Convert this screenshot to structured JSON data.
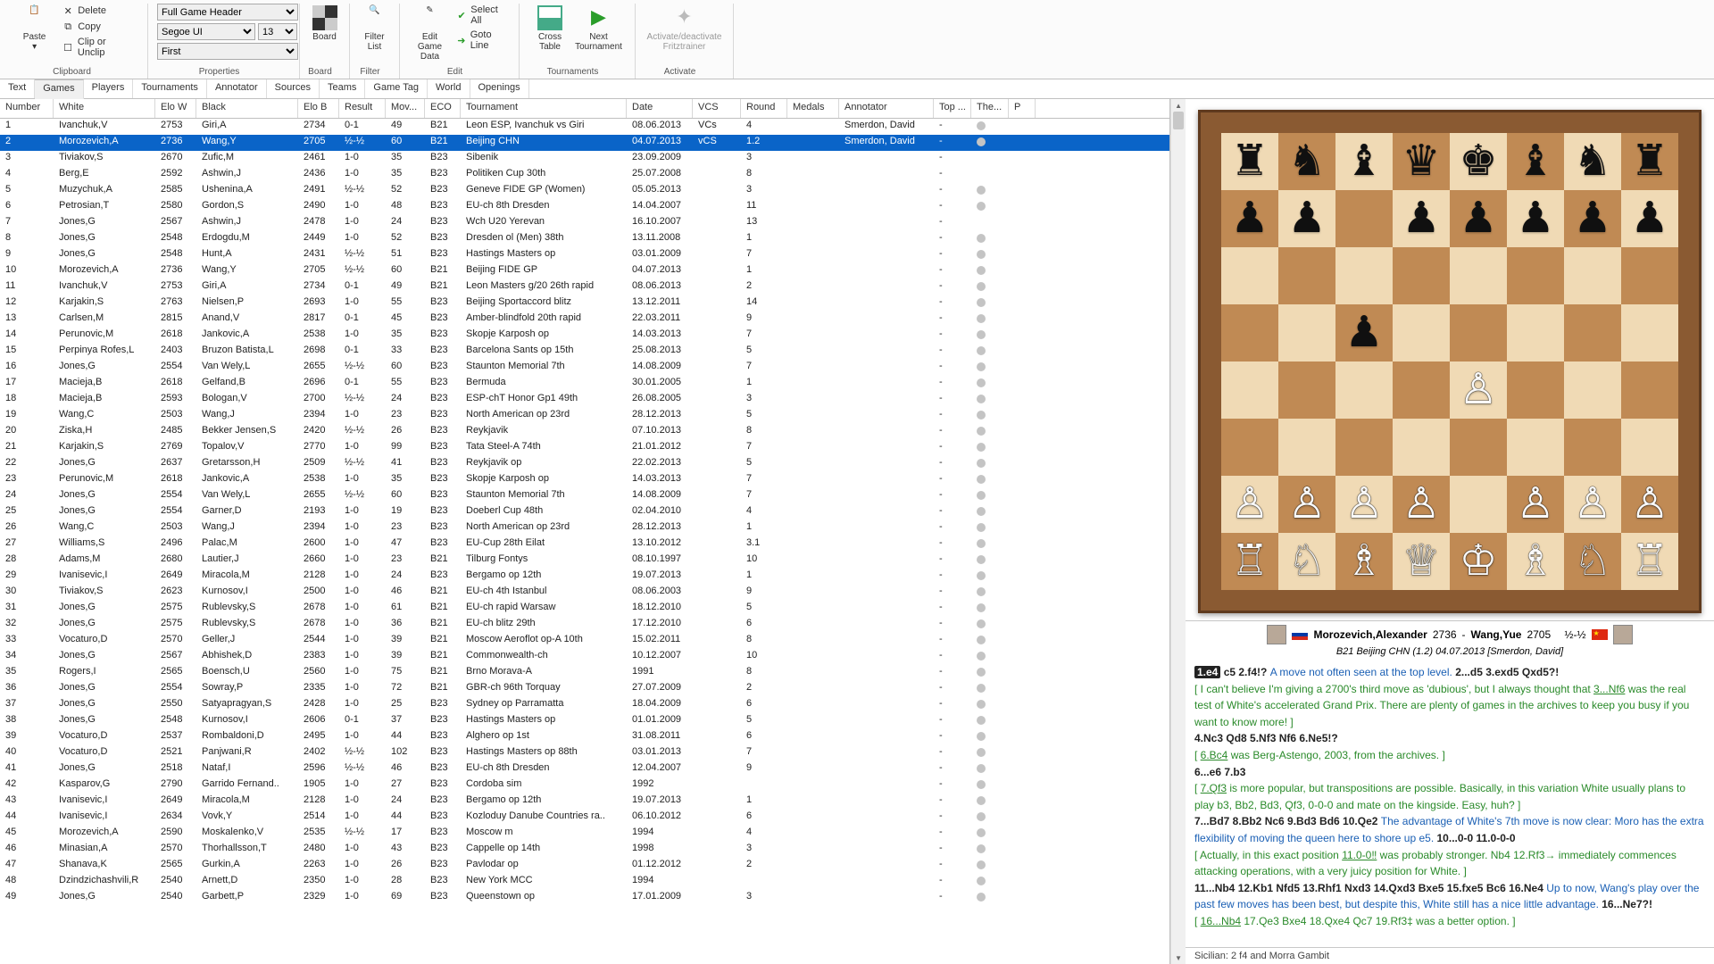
{
  "ribbon": {
    "clipboard": {
      "label": "Clipboard",
      "paste": "Paste",
      "delete": "Delete",
      "copy": "Copy",
      "clip": "Clip or Unclip"
    },
    "properties": {
      "label": "Properties",
      "style": "Full Game Header",
      "font": "Segoe UI",
      "size": "13",
      "row": "First"
    },
    "board_grp": {
      "label": "Board",
      "board": "Board"
    },
    "filter": {
      "label": "Filter",
      "list": "Filter List"
    },
    "edit": {
      "label": "Edit",
      "editgame": "Edit Game Data",
      "selectall": "Select All",
      "gotoline": "Goto Line"
    },
    "tournaments": {
      "label": "Tournaments",
      "cross": "Cross Table",
      "next": "Next Tournament"
    },
    "activate": {
      "label": "Activate",
      "act": "Activate/deactivate Fritztrainer"
    }
  },
  "tabs": [
    "Text",
    "Games",
    "Players",
    "Tournaments",
    "Annotator",
    "Sources",
    "Teams",
    "Game Tag",
    "World",
    "Openings"
  ],
  "active_tab": 1,
  "columns": [
    "Number",
    "White",
    "Elo W",
    "Black",
    "Elo B",
    "Result",
    "Mov...",
    "ECO",
    "Tournament",
    "Date",
    "VCS",
    "Round",
    "Medals",
    "Annotator",
    "Top ...",
    "The...",
    "P"
  ],
  "rows": [
    {
      "n": 1,
      "w": "Ivanchuk,V",
      "ew": 2753,
      "b": "Giri,A",
      "eb": 2734,
      "r": "0-1",
      "m": 49,
      "eco": "B21",
      "t": "Leon ESP, Ivanchuk vs Giri",
      "d": "08.06.2013",
      "vcs": "VCs",
      "rd": "4",
      "ann": "Smerdon, David",
      "top": "-",
      "th": true
    },
    {
      "n": 2,
      "w": "Morozevich,A",
      "ew": 2736,
      "b": "Wang,Y",
      "eb": 2705,
      "r": "½-½",
      "m": 60,
      "eco": "B21",
      "t": "Beijing CHN",
      "d": "04.07.2013",
      "vcs": "vCS",
      "rd": "1.2",
      "ann": "Smerdon, David",
      "top": "-",
      "th": true,
      "sel": true
    },
    {
      "n": 3,
      "w": "Tiviakov,S",
      "ew": 2670,
      "b": "Zufic,M",
      "eb": 2461,
      "r": "1-0",
      "m": 35,
      "eco": "B23",
      "t": "Sibenik",
      "d": "23.09.2009",
      "rd": "3",
      "top": "-"
    },
    {
      "n": 4,
      "w": "Berg,E",
      "ew": 2592,
      "b": "Ashwin,J",
      "eb": 2436,
      "r": "1-0",
      "m": 35,
      "eco": "B23",
      "t": "Politiken Cup 30th",
      "d": "25.07.2008",
      "rd": "8",
      "top": "-"
    },
    {
      "n": 5,
      "w": "Muzychuk,A",
      "ew": 2585,
      "b": "Ushenina,A",
      "eb": 2491,
      "r": "½-½",
      "m": 52,
      "eco": "B23",
      "t": "Geneve FIDE GP (Women)",
      "d": "05.05.2013",
      "rd": "3",
      "top": "-",
      "th": true
    },
    {
      "n": 6,
      "w": "Petrosian,T",
      "ew": 2580,
      "b": "Gordon,S",
      "eb": 2490,
      "r": "1-0",
      "m": 48,
      "eco": "B23",
      "t": "EU-ch 8th Dresden",
      "d": "14.04.2007",
      "rd": "11",
      "top": "-",
      "th": true
    },
    {
      "n": 7,
      "w": "Jones,G",
      "ew": 2567,
      "b": "Ashwin,J",
      "eb": 2478,
      "r": "1-0",
      "m": 24,
      "eco": "B23",
      "t": "Wch U20 Yerevan",
      "d": "16.10.2007",
      "rd": "13",
      "top": "-"
    },
    {
      "n": 8,
      "w": "Jones,G",
      "ew": 2548,
      "b": "Erdogdu,M",
      "eb": 2449,
      "r": "1-0",
      "m": 52,
      "eco": "B23",
      "t": "Dresden ol (Men) 38th",
      "d": "13.11.2008",
      "rd": "1",
      "top": "-",
      "th": true
    },
    {
      "n": 9,
      "w": "Jones,G",
      "ew": 2548,
      "b": "Hunt,A",
      "eb": 2431,
      "r": "½-½",
      "m": 51,
      "eco": "B23",
      "t": "Hastings Masters op",
      "d": "03.01.2009",
      "rd": "7",
      "top": "-",
      "th": true
    },
    {
      "n": 10,
      "w": "Morozevich,A",
      "ew": 2736,
      "b": "Wang,Y",
      "eb": 2705,
      "r": "½-½",
      "m": 60,
      "eco": "B21",
      "t": "Beijing FIDE GP",
      "d": "04.07.2013",
      "rd": "1",
      "top": "-",
      "th": true
    },
    {
      "n": 11,
      "w": "Ivanchuk,V",
      "ew": 2753,
      "b": "Giri,A",
      "eb": 2734,
      "r": "0-1",
      "m": 49,
      "eco": "B21",
      "t": "Leon Masters g/20 26th rapid",
      "d": "08.06.2013",
      "rd": "2",
      "top": "-",
      "th": true
    },
    {
      "n": 12,
      "w": "Karjakin,S",
      "ew": 2763,
      "b": "Nielsen,P",
      "eb": 2693,
      "r": "1-0",
      "m": 55,
      "eco": "B23",
      "t": "Beijing Sportaccord blitz",
      "d": "13.12.2011",
      "rd": "14",
      "top": "-",
      "th": true
    },
    {
      "n": 13,
      "w": "Carlsen,M",
      "ew": 2815,
      "b": "Anand,V",
      "eb": 2817,
      "r": "0-1",
      "m": 45,
      "eco": "B23",
      "t": "Amber-blindfold 20th rapid",
      "d": "22.03.2011",
      "rd": "9",
      "top": "-",
      "th": true
    },
    {
      "n": 14,
      "w": "Perunovic,M",
      "ew": 2618,
      "b": "Jankovic,A",
      "eb": 2538,
      "r": "1-0",
      "m": 35,
      "eco": "B23",
      "t": "Skopje Karposh op",
      "d": "14.03.2013",
      "rd": "7",
      "top": "-",
      "th": true
    },
    {
      "n": 15,
      "w": "Perpinya Rofes,L",
      "ew": 2403,
      "b": "Bruzon Batista,L",
      "eb": 2698,
      "r": "0-1",
      "m": 33,
      "eco": "B23",
      "t": "Barcelona Sants op 15th",
      "d": "25.08.2013",
      "rd": "5",
      "top": "-",
      "th": true
    },
    {
      "n": 16,
      "w": "Jones,G",
      "ew": 2554,
      "b": "Van Wely,L",
      "eb": 2655,
      "r": "½-½",
      "m": 60,
      "eco": "B23",
      "t": "Staunton Memorial 7th",
      "d": "14.08.2009",
      "rd": "7",
      "top": "-",
      "th": true
    },
    {
      "n": 17,
      "w": "Macieja,B",
      "ew": 2618,
      "b": "Gelfand,B",
      "eb": 2696,
      "r": "0-1",
      "m": 55,
      "eco": "B23",
      "t": "Bermuda",
      "d": "30.01.2005",
      "rd": "1",
      "top": "-",
      "th": true
    },
    {
      "n": 18,
      "w": "Macieja,B",
      "ew": 2593,
      "b": "Bologan,V",
      "eb": 2700,
      "r": "½-½",
      "m": 24,
      "eco": "B23",
      "t": "ESP-chT Honor Gp1 49th",
      "d": "26.08.2005",
      "rd": "3",
      "top": "-",
      "th": true
    },
    {
      "n": 19,
      "w": "Wang,C",
      "ew": 2503,
      "b": "Wang,J",
      "eb": 2394,
      "r": "1-0",
      "m": 23,
      "eco": "B23",
      "t": "North American op 23rd",
      "d": "28.12.2013",
      "rd": "5",
      "top": "-",
      "th": true
    },
    {
      "n": 20,
      "w": "Ziska,H",
      "ew": 2485,
      "b": "Bekker Jensen,S",
      "eb": 2420,
      "r": "½-½",
      "m": 26,
      "eco": "B23",
      "t": "Reykjavik",
      "d": "07.10.2013",
      "rd": "8",
      "top": "-",
      "th": true
    },
    {
      "n": 21,
      "w": "Karjakin,S",
      "ew": 2769,
      "b": "Topalov,V",
      "eb": 2770,
      "r": "1-0",
      "m": 99,
      "eco": "B23",
      "t": "Tata Steel-A 74th",
      "d": "21.01.2012",
      "rd": "7",
      "top": "-",
      "th": true
    },
    {
      "n": 22,
      "w": "Jones,G",
      "ew": 2637,
      "b": "Gretarsson,H",
      "eb": 2509,
      "r": "½-½",
      "m": 41,
      "eco": "B23",
      "t": "Reykjavik op",
      "d": "22.02.2013",
      "rd": "5",
      "top": "-",
      "th": true
    },
    {
      "n": 23,
      "w": "Perunovic,M",
      "ew": 2618,
      "b": "Jankovic,A",
      "eb": 2538,
      "r": "1-0",
      "m": 35,
      "eco": "B23",
      "t": "Skopje Karposh op",
      "d": "14.03.2013",
      "rd": "7",
      "top": "-",
      "th": true
    },
    {
      "n": 24,
      "w": "Jones,G",
      "ew": 2554,
      "b": "Van Wely,L",
      "eb": 2655,
      "r": "½-½",
      "m": 60,
      "eco": "B23",
      "t": "Staunton Memorial 7th",
      "d": "14.08.2009",
      "rd": "7",
      "top": "-",
      "th": true
    },
    {
      "n": 25,
      "w": "Jones,G",
      "ew": 2554,
      "b": "Garner,D",
      "eb": 2193,
      "r": "1-0",
      "m": 19,
      "eco": "B23",
      "t": "Doeberl Cup 48th",
      "d": "02.04.2010",
      "rd": "4",
      "top": "-",
      "th": true
    },
    {
      "n": 26,
      "w": "Wang,C",
      "ew": 2503,
      "b": "Wang,J",
      "eb": 2394,
      "r": "1-0",
      "m": 23,
      "eco": "B23",
      "t": "North American op 23rd",
      "d": "28.12.2013",
      "rd": "1",
      "top": "-",
      "th": true
    },
    {
      "n": 27,
      "w": "Williams,S",
      "ew": 2496,
      "b": "Palac,M",
      "eb": 2600,
      "r": "1-0",
      "m": 47,
      "eco": "B23",
      "t": "EU-Cup 28th Eilat",
      "d": "13.10.2012",
      "rd": "3.1",
      "top": "-",
      "th": true
    },
    {
      "n": 28,
      "w": "Adams,M",
      "ew": 2680,
      "b": "Lautier,J",
      "eb": 2660,
      "r": "1-0",
      "m": 23,
      "eco": "B21",
      "t": "Tilburg Fontys",
      "d": "08.10.1997",
      "rd": "10",
      "top": "-",
      "th": true
    },
    {
      "n": 29,
      "w": "Ivanisevic,I",
      "ew": 2649,
      "b": "Miracola,M",
      "eb": 2128,
      "r": "1-0",
      "m": 24,
      "eco": "B23",
      "t": "Bergamo op 12th",
      "d": "19.07.2013",
      "rd": "1",
      "top": "-",
      "th": true
    },
    {
      "n": 30,
      "w": "Tiviakov,S",
      "ew": 2623,
      "b": "Kurnosov,I",
      "eb": 2500,
      "r": "1-0",
      "m": 46,
      "eco": "B21",
      "t": "EU-ch 4th Istanbul",
      "d": "08.06.2003",
      "rd": "9",
      "top": "-",
      "th": true
    },
    {
      "n": 31,
      "w": "Jones,G",
      "ew": 2575,
      "b": "Rublevsky,S",
      "eb": 2678,
      "r": "1-0",
      "m": 61,
      "eco": "B21",
      "t": "EU-ch rapid Warsaw",
      "d": "18.12.2010",
      "rd": "5",
      "top": "-",
      "th": true
    },
    {
      "n": 32,
      "w": "Jones,G",
      "ew": 2575,
      "b": "Rublevsky,S",
      "eb": 2678,
      "r": "1-0",
      "m": 36,
      "eco": "B21",
      "t": "EU-ch blitz 29th",
      "d": "17.12.2010",
      "rd": "6",
      "top": "-",
      "th": true
    },
    {
      "n": 33,
      "w": "Vocaturo,D",
      "ew": 2570,
      "b": "Geller,J",
      "eb": 2544,
      "r": "1-0",
      "m": 39,
      "eco": "B21",
      "t": "Moscow Aeroflot op-A 10th",
      "d": "15.02.2011",
      "rd": "8",
      "top": "-",
      "th": true
    },
    {
      "n": 34,
      "w": "Jones,G",
      "ew": 2567,
      "b": "Abhishek,D",
      "eb": 2383,
      "r": "1-0",
      "m": 39,
      "eco": "B21",
      "t": "Commonwealth-ch",
      "d": "10.12.2007",
      "rd": "10",
      "top": "-",
      "th": true
    },
    {
      "n": 35,
      "w": "Rogers,I",
      "ew": 2565,
      "b": "Boensch,U",
      "eb": 2560,
      "r": "1-0",
      "m": 75,
      "eco": "B21",
      "t": "Brno Morava-A",
      "d": "1991",
      "rd": "8",
      "top": "-",
      "th": true
    },
    {
      "n": 36,
      "w": "Jones,G",
      "ew": 2554,
      "b": "Sowray,P",
      "eb": 2335,
      "r": "1-0",
      "m": 72,
      "eco": "B21",
      "t": "GBR-ch 96th Torquay",
      "d": "27.07.2009",
      "rd": "2",
      "top": "-",
      "th": true
    },
    {
      "n": 37,
      "w": "Jones,G",
      "ew": 2550,
      "b": "Satyapragyan,S",
      "eb": 2428,
      "r": "1-0",
      "m": 25,
      "eco": "B23",
      "t": "Sydney op Parramatta",
      "d": "18.04.2009",
      "rd": "6",
      "top": "-",
      "th": true
    },
    {
      "n": 38,
      "w": "Jones,G",
      "ew": 2548,
      "b": "Kurnosov,I",
      "eb": 2606,
      "r": "0-1",
      "m": 37,
      "eco": "B23",
      "t": "Hastings Masters op",
      "d": "01.01.2009",
      "rd": "5",
      "top": "-",
      "th": true
    },
    {
      "n": 39,
      "w": "Vocaturo,D",
      "ew": 2537,
      "b": "Rombaldoni,D",
      "eb": 2495,
      "r": "1-0",
      "m": 44,
      "eco": "B23",
      "t": "Alghero op 1st",
      "d": "31.08.2011",
      "rd": "6",
      "top": "-",
      "th": true
    },
    {
      "n": 40,
      "w": "Vocaturo,D",
      "ew": 2521,
      "b": "Panjwani,R",
      "eb": 2402,
      "r": "½-½",
      "m": 102,
      "eco": "B23",
      "t": "Hastings Masters op 88th",
      "d": "03.01.2013",
      "rd": "7",
      "top": "-",
      "th": true
    },
    {
      "n": 41,
      "w": "Jones,G",
      "ew": 2518,
      "b": "Nataf,I",
      "eb": 2596,
      "r": "½-½",
      "m": 46,
      "eco": "B23",
      "t": "EU-ch 8th Dresden",
      "d": "12.04.2007",
      "rd": "9",
      "top": "-",
      "th": true
    },
    {
      "n": 42,
      "w": "Kasparov,G",
      "ew": 2790,
      "b": "Garrido Fernand..",
      "eb": 1905,
      "r": "1-0",
      "m": 27,
      "eco": "B23",
      "t": "Cordoba sim",
      "d": "1992",
      "rd": "",
      "top": "-",
      "th": true
    },
    {
      "n": 43,
      "w": "Ivanisevic,I",
      "ew": 2649,
      "b": "Miracola,M",
      "eb": 2128,
      "r": "1-0",
      "m": 24,
      "eco": "B23",
      "t": "Bergamo op 12th",
      "d": "19.07.2013",
      "rd": "1",
      "top": "-",
      "th": true
    },
    {
      "n": 44,
      "w": "Ivanisevic,I",
      "ew": 2634,
      "b": "Vovk,Y",
      "eb": 2514,
      "r": "1-0",
      "m": 44,
      "eco": "B23",
      "t": "Kozloduy Danube Countries ra..",
      "d": "06.10.2012",
      "rd": "6",
      "top": "-",
      "th": true
    },
    {
      "n": 45,
      "w": "Morozevich,A",
      "ew": 2590,
      "b": "Moskalenko,V",
      "eb": 2535,
      "r": "½-½",
      "m": 17,
      "eco": "B23",
      "t": "Moscow m",
      "d": "1994",
      "rd": "4",
      "top": "-",
      "th": true
    },
    {
      "n": 46,
      "w": "Minasian,A",
      "ew": 2570,
      "b": "Thorhallsson,T",
      "eb": 2480,
      "r": "1-0",
      "m": 43,
      "eco": "B23",
      "t": "Cappelle op 14th",
      "d": "1998",
      "rd": "3",
      "top": "-",
      "th": true
    },
    {
      "n": 47,
      "w": "Shanava,K",
      "ew": 2565,
      "b": "Gurkin,A",
      "eb": 2263,
      "r": "1-0",
      "m": 26,
      "eco": "B23",
      "t": "Pavlodar op",
      "d": "01.12.2012",
      "rd": "2",
      "top": "-",
      "th": true
    },
    {
      "n": 48,
      "w": "Dzindzichashvili,R",
      "ew": 2540,
      "b": "Arnett,D",
      "eb": 2350,
      "r": "1-0",
      "m": 28,
      "eco": "B23",
      "t": "New York MCC",
      "d": "1994",
      "rd": "",
      "top": "-",
      "th": true
    },
    {
      "n": 49,
      "w": "Jones,G",
      "ew": 2540,
      "b": "Garbett,P",
      "eb": 2329,
      "r": "1-0",
      "m": 69,
      "eco": "B23",
      "t": "Queenstown op",
      "d": "17.01.2009",
      "rd": "3",
      "top": "-",
      "th": true
    }
  ],
  "board": {
    "position": "rnbqkbnr/pp1ppppp/8/2p5/4P3/8/PPPP1PPP/RNBQKBNR"
  },
  "game": {
    "white": "Morozevich,Alexander",
    "welo": "2736",
    "black": "Wang,Yue",
    "belo": "2705",
    "result": "½-½",
    "sub": "B21 Beijing CHN (1.2) 04.07.2013 [Smerdon, David]"
  },
  "notation_lines": [
    {
      "t": "mvbold",
      "txt": "1.e4",
      "hl": true
    },
    {
      "t": "mv",
      "txt": " c5  2.f4!? "
    },
    {
      "t": "ann",
      "txt": "A move not often seen at the top level."
    },
    {
      "t": "mv",
      "txt": "  2...d5  3.exd5  Qxd5?!"
    },
    {
      "t": "br"
    },
    {
      "t": "sub",
      "txt": "[ I can't believe I'm giving a 2700's third move as 'dubious', but I always thought that "
    },
    {
      "t": "subu",
      "txt": "3...Nf6"
    },
    {
      "t": "sub",
      "txt": " was the real test of White's accelerated Grand Prix. There are plenty of games in the archives to keep you busy if you want to know more! ]"
    },
    {
      "t": "br"
    },
    {
      "t": "mv",
      "txt": "4.Nc3  Qd8  5.Nf3  Nf6  6.Ne5!?"
    },
    {
      "t": "br"
    },
    {
      "t": "sub",
      "txt": "[ "
    },
    {
      "t": "subu",
      "txt": "6.Bc4"
    },
    {
      "t": "sub",
      "txt": " was Berg-Astengo, 2003, from the archives. ]"
    },
    {
      "t": "br"
    },
    {
      "t": "mv",
      "txt": "6...e6  7.b3"
    },
    {
      "t": "br"
    },
    {
      "t": "sub",
      "txt": "[ "
    },
    {
      "t": "subu",
      "txt": "7.Qf3"
    },
    {
      "t": "sub",
      "txt": " is more popular, but transpositions are possible. Basically, in this variation White usually plans to play b3, Bb2, Bd3, Qf3, 0-0-0 and mate on the kingside. Easy, huh? ]"
    },
    {
      "t": "br"
    },
    {
      "t": "mv",
      "txt": "7...Bd7  8.Bb2  Nc6  9.Bd3  Bd6  10.Qe2 "
    },
    {
      "t": "ann",
      "txt": "The advantage of White's 7th move is now clear: Moro has the extra flexibility of moving the queen here to shore up e5."
    },
    {
      "t": "mv",
      "txt": "  10...0-0  11.0-0-0"
    },
    {
      "t": "br"
    },
    {
      "t": "sub",
      "txt": "[ Actually, in this exact position "
    },
    {
      "t": "subu",
      "txt": "11.0-0‼"
    },
    {
      "t": "sub",
      "txt": " was probably stronger.  Nb4  12.Rf3→ immediately commences attacking operations, with a very juicy position for White. ]"
    },
    {
      "t": "br"
    },
    {
      "t": "mv",
      "txt": "11...Nb4  12.Kb1  Nfd5  13.Rhf1  Nxd3  14.Qxd3  Bxe5  15.fxe5  Bc6  16.Ne4 "
    },
    {
      "t": "ann",
      "txt": "Up to now, Wang's play over the past few moves has been best, but despite this, White still has a nice little advantage."
    },
    {
      "t": "mv",
      "txt": "  16...Ne7?!"
    },
    {
      "t": "br"
    },
    {
      "t": "sub",
      "txt": "[ "
    },
    {
      "t": "subu",
      "txt": "16...Nb4"
    },
    {
      "t": "sub",
      "txt": "  17.Qe3  Bxe4  18.Qxe4  Qc7  19.Rf3‡ was a better option. ]"
    }
  ],
  "opening": "Sicilian: 2 f4 and Morra Gambit"
}
